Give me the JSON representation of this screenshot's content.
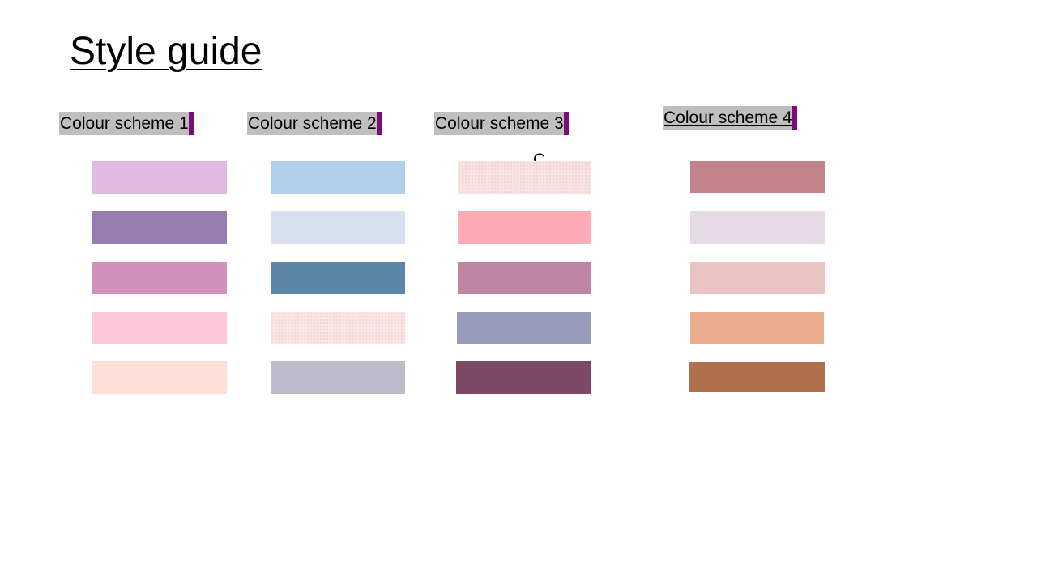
{
  "page": {
    "title": "Style guide",
    "stray_text": "C"
  },
  "schemes": [
    {
      "heading": "Colour scheme 1",
      "swatches": [
        "#e0bae3",
        "#977daf",
        "#d290bc",
        "#fdc6d9",
        "#fedfd6"
      ]
    },
    {
      "heading": "Colour scheme 2",
      "swatches": [
        "#b1cfeb",
        "#d8dff1",
        "#5b86a9",
        "#f8e5e4",
        "#bebbca"
      ]
    },
    {
      "heading": "Colour scheme 3",
      "swatches": [
        "#f8e2e2",
        "#feabb6",
        "#bd84a3",
        "#989bba",
        "#7c4866"
      ]
    },
    {
      "heading": "Colour scheme 4",
      "swatches": [
        "#c1828a",
        "#e6dbe4",
        "#eac4c3",
        "#ebad8d",
        "#b06f4d"
      ]
    }
  ],
  "colors": {
    "heading_highlight": "#bfbfbf",
    "heading_marker": "#7a0d7a"
  }
}
